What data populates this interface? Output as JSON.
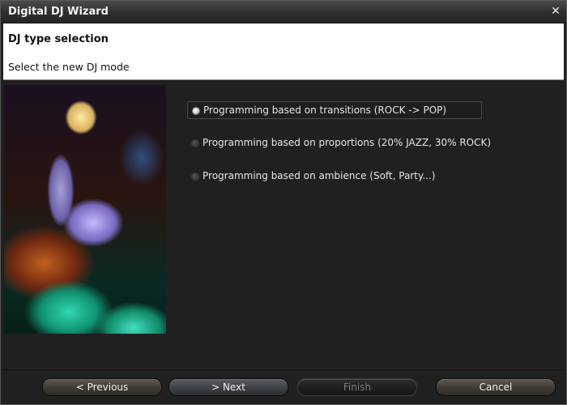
{
  "window": {
    "title": "Digital DJ Wizard",
    "close_icon": "close-icon"
  },
  "header": {
    "title": "DJ type selection",
    "subtitle": "Select the new DJ mode"
  },
  "image": {
    "icon": "dj-photo"
  },
  "options": [
    {
      "label": "Programming based on transitions (ROCK -> POP)",
      "selected": true
    },
    {
      "label": "Programming based on proportions (20% JAZZ, 30% ROCK)",
      "selected": false
    },
    {
      "label": "Programming based on ambience (Soft, Party...)",
      "selected": false
    }
  ],
  "buttons": {
    "previous": "< Previous",
    "next": "> Next",
    "finish": "Finish",
    "cancel": "Cancel"
  },
  "colors": {
    "header_bg": "#ffffff",
    "window_bg": "#202020",
    "text_light": "#e6e6e6",
    "disabled_text": "#7a7a7a"
  }
}
